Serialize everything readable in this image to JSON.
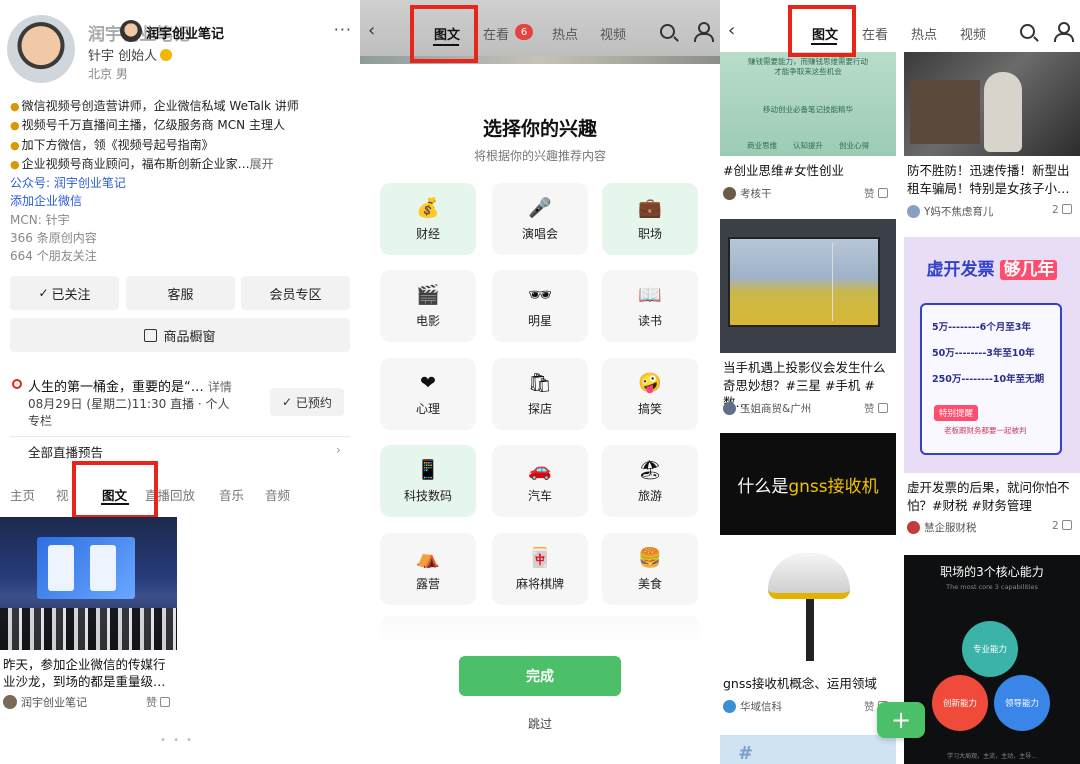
{
  "panel1": {
    "title": "润宇创业笔记",
    "title_overlay": "润宇创业笔记",
    "role": "针宇 创始人",
    "location": "北京 男",
    "bio": [
      "微信视频号创造营讲师，企业微信私域 WeTalk 讲师",
      "视频号千万直播间主播，亿级服务商 MCN 主理人",
      "加下方微信，领《视频号起号指南》",
      "企业视频号商业顾问，福布斯创新企业家…"
    ],
    "bio_expand": "展开",
    "official_account": "公众号: 润宇创业笔记",
    "add_wecom": "添加企业微信",
    "mcn": "MCN: 针宇",
    "original_count": "366 条原创内容",
    "friends_count": "664 个朋友关注",
    "buttons": {
      "followed": "已关注",
      "service": "客服",
      "member": "会员专区",
      "shop": "商品橱窗"
    },
    "live": {
      "title": "人生的第一桶金，重要的是“…",
      "detail": "详情",
      "time": "08月29日 (星期二)11:30 直播 · 个人专栏",
      "reserved": "已预约"
    },
    "all_preview": "全部直播预告",
    "tabs": [
      "主页",
      "视",
      "图文",
      "直播回放",
      "音乐",
      "音频"
    ],
    "post": {
      "title": "昨天，参加企业微信的传媒行业沙龙，到场的都是重量级…",
      "author": "润宇创业笔记",
      "like": "赞"
    }
  },
  "panel2": {
    "tabs": [
      "图文",
      "在看",
      "热点",
      "视频"
    ],
    "badge": "6",
    "heading": "选择你的兴趣",
    "subheading": "将根据你的兴趣推荐内容",
    "interests": [
      {
        "label": "财经",
        "icon": "💰",
        "icon_name": "money-bag-icon",
        "selected": true
      },
      {
        "label": "演唱会",
        "icon": "🎤",
        "icon_name": "microphone-icon",
        "selected": false
      },
      {
        "label": "职场",
        "icon": "💼",
        "icon_name": "briefcase-icon",
        "selected": true
      },
      {
        "label": "电影",
        "icon": "🎬",
        "icon_name": "clapperboard-icon",
        "selected": false
      },
      {
        "label": "明星",
        "icon": "🕶",
        "icon_name": "sunglasses-icon",
        "selected": false
      },
      {
        "label": "读书",
        "icon": "📖",
        "icon_name": "open-book-icon",
        "selected": false
      },
      {
        "label": "心理",
        "icon": "❤",
        "icon_name": "heart-icon",
        "selected": false
      },
      {
        "label": "探店",
        "icon": "🛍",
        "icon_name": "shopping-bags-icon",
        "selected": false
      },
      {
        "label": "搞笑",
        "icon": "🤪",
        "icon_name": "zany-face-icon",
        "selected": false
      },
      {
        "label": "科技数码",
        "icon": "📱",
        "icon_name": "mobile-phone-icon",
        "selected": true
      },
      {
        "label": "汽车",
        "icon": "🚗",
        "icon_name": "car-icon",
        "selected": false
      },
      {
        "label": "旅游",
        "icon": "🏖",
        "icon_name": "beach-icon",
        "selected": false
      },
      {
        "label": "露营",
        "icon": "⛺",
        "icon_name": "tent-icon",
        "selected": false
      },
      {
        "label": "麻将棋牌",
        "icon": "🀄",
        "icon_name": "mahjong-icon",
        "selected": false
      },
      {
        "label": "美食",
        "icon": "🍔",
        "icon_name": "burger-icon",
        "selected": false
      }
    ],
    "done": "完成",
    "skip": "跳过"
  },
  "panel3": {
    "tabs": [
      "图文",
      "在看",
      "热点",
      "视频"
    ],
    "img_a_lines": [
      "赚钱需要能力，而赚钱思维需要行动",
      "才能争取来这些机会",
      "移动创业必备笔记技能精华",
      "商业思维",
      "认知提升",
      "创业心得"
    ],
    "cards": [
      {
        "title": "#创业思维#女性创业",
        "author": "考核干",
        "like": "赞"
      },
      {
        "title": "防不胜防！迅速传播！新型出租车骗局！特别是女孩子小…",
        "author": "Y妈不焦虑育儿",
        "like": "2"
      },
      {
        "title": "当手机遇上投影仪会发生什么奇思妙想？#三星 #手机 #数…",
        "author": "玉姐商贸&广州",
        "like": "赞"
      },
      {
        "title": "虚开发票的后果，就问你怕不怕？#财税 #财务管理",
        "author": "慧企服财税",
        "like": "2"
      },
      {
        "title": "gnss接收机概念、运用领域",
        "author": "华域信科",
        "like": "赞"
      }
    ],
    "invoice": {
      "banner_a": "虚开发票",
      "banner_b": "够几年",
      "rows": [
        "5万--------6个月至3年",
        "50万--------3年至10年",
        "250万--------10年至无期"
      ],
      "tag": "特别提醒",
      "note": "老板跟财务都要一起被判"
    },
    "gnss_header_a": "什么是",
    "gnss_header_b": "gnss接收机",
    "abilities": {
      "title": "职场的3个核心能力",
      "subtitle": "The most core 3 capabilities",
      "c1": "专业能力",
      "c2": "创新能力",
      "c3": "领导能力",
      "caption": "学习大局观，主流，主动，主导..."
    },
    "img_g_text": "#",
    "fab": "+"
  },
  "colors": {
    "highlight_box": "#e8251b",
    "accent_green": "#4cbf69",
    "link_blue": "#2b5bd7",
    "badge_red": "#e64340"
  }
}
